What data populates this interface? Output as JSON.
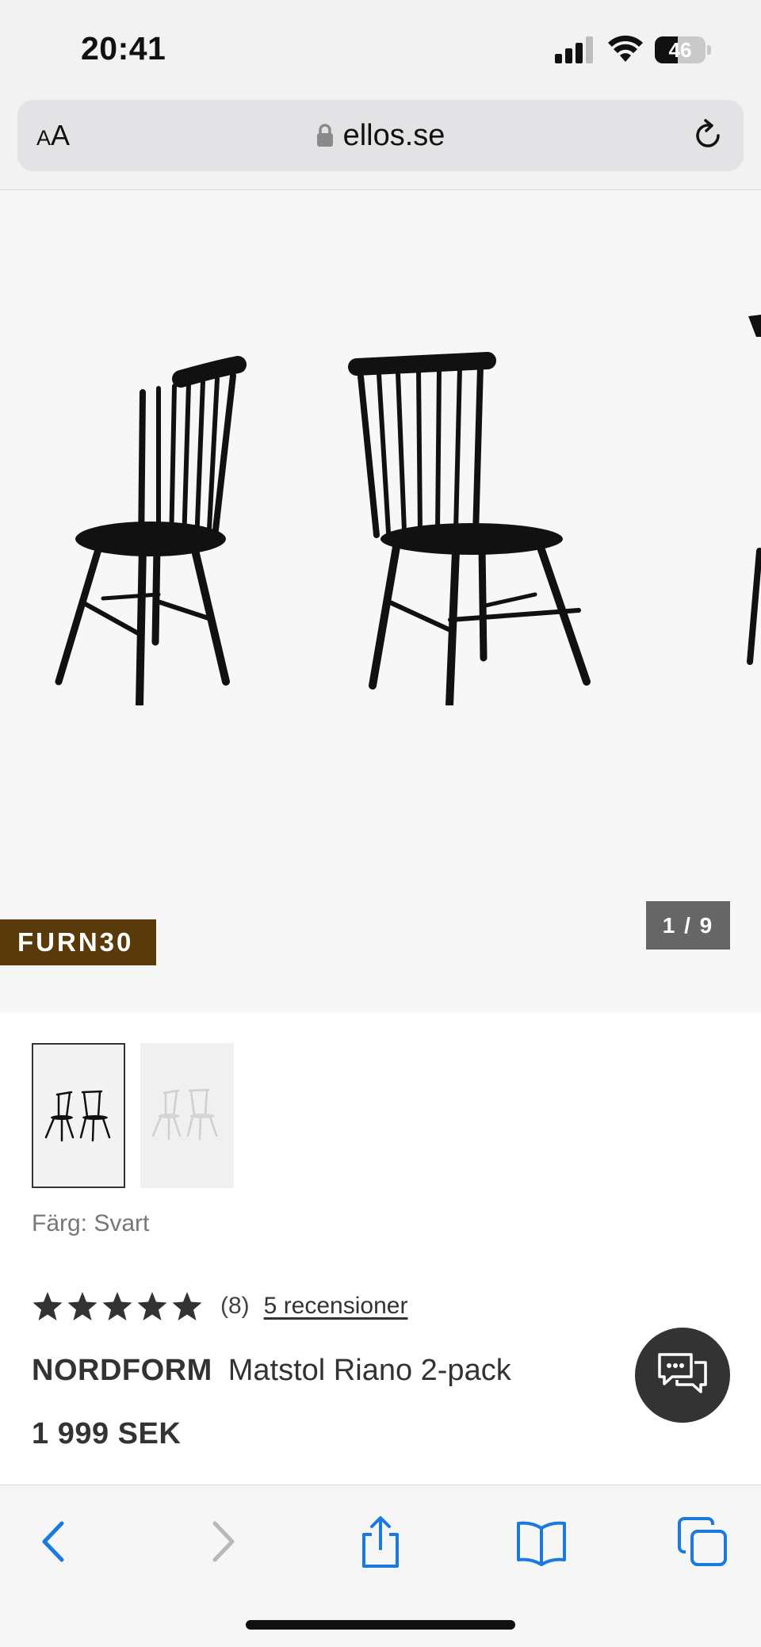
{
  "status_bar": {
    "time": "20:41",
    "battery_level": "46",
    "battery_fraction": 0.46
  },
  "address_bar": {
    "text_size_label": "AA",
    "url": "ellos.se",
    "lock_icon": "lock-icon",
    "reload_icon": "reload-icon"
  },
  "gallery": {
    "promo_code": "FURN30",
    "page_counter": "1 / 9",
    "current_image": 1,
    "total_images": 9
  },
  "thumbnails": [
    {
      "color": "black",
      "selected": true
    },
    {
      "color": "white",
      "selected": false
    }
  ],
  "product": {
    "color_label": "Färg: Svart",
    "rating_stars": 5,
    "rating_count": "(8)",
    "reviews_link": "5 recensioner",
    "brand": "NORDFORM",
    "name": "Matstol Riano 2-pack",
    "price": "1 999 SEK"
  },
  "toolbar": {
    "icons": [
      "back-icon",
      "forward-icon",
      "share-icon",
      "bookmarks-icon",
      "tabs-icon"
    ]
  },
  "colors": {
    "promo_badge_bg": "#5a3a0b",
    "counter_bg": "#666666",
    "safari_blue": "#1a7ae0",
    "chat_bg": "#333333"
  }
}
